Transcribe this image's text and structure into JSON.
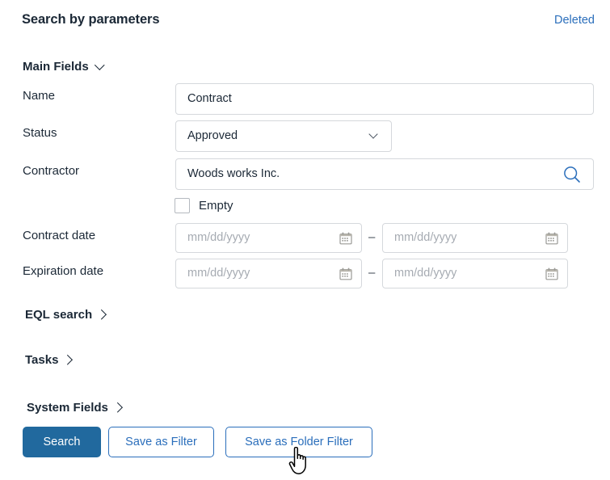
{
  "header": {
    "title": "Search by parameters",
    "deleted_link": "Deleted"
  },
  "sections": {
    "main_fields": {
      "label": "Main Fields",
      "chevron": "chevron-down-icon",
      "expanded": true
    },
    "eql_search": {
      "label": "EQL search",
      "chevron": "chevron-right-icon",
      "expanded": false
    },
    "tasks": {
      "label": "Tasks",
      "chevron": "chevron-right-icon",
      "expanded": false
    },
    "system_fields": {
      "label": "System Fields",
      "chevron": "chevron-right-icon",
      "expanded": false
    }
  },
  "fields": {
    "name": {
      "label": "Name",
      "value": "Contract"
    },
    "status": {
      "label": "Status",
      "value": "Approved",
      "chevron": "chevron-down-icon"
    },
    "contractor": {
      "label": "Contractor",
      "value": "Woods works Inc.",
      "icon": "search-icon",
      "empty_checkbox_label": "Empty",
      "empty_checked": false
    },
    "contract_date": {
      "label": "Contract date",
      "from_placeholder": "mm/dd/yyyy",
      "to_placeholder": "mm/dd/yyyy",
      "separator": "–",
      "icon": "calendar-icon"
    },
    "expiration_date": {
      "label": "Expiration date",
      "from_placeholder": "mm/dd/yyyy",
      "to_placeholder": "mm/dd/yyyy",
      "separator": "–",
      "icon": "calendar-icon"
    }
  },
  "buttons": {
    "search": "Search",
    "save_as_filter": "Save as Filter",
    "save_as_folder_filter": "Save as Folder Filter"
  },
  "cursor": {
    "type": "pointing-hand-cursor"
  },
  "colors": {
    "primary_button_bg": "#21699e",
    "link_blue": "#2a6ebb",
    "text_dark": "#1b2836",
    "placeholder_gray": "#a6abb2",
    "input_border": "#d5d8dc"
  }
}
